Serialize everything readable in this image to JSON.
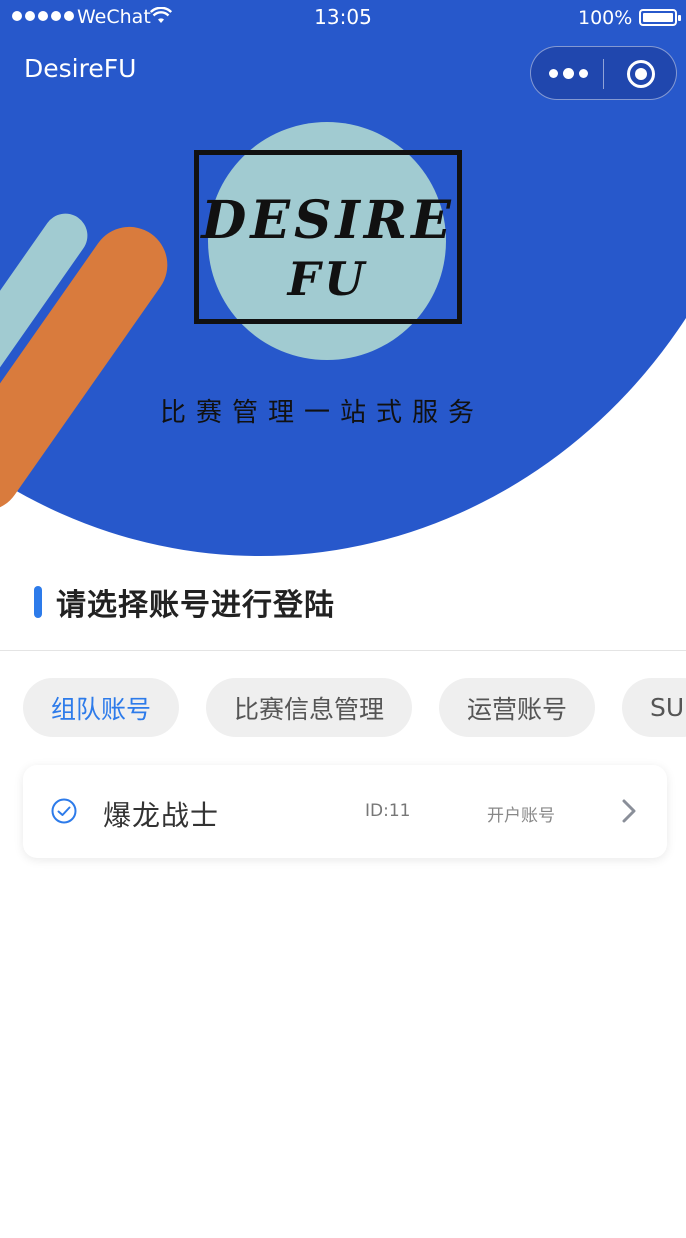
{
  "status_bar": {
    "carrier": "WeChat",
    "time": "13:05",
    "battery": "100%"
  },
  "nav": {
    "title": "DesireFU"
  },
  "hero": {
    "logo_line1": "DESIRE",
    "logo_line2": "FU",
    "tagline": "比赛管理一站式服务"
  },
  "section": {
    "title": "请选择账号进行登陆"
  },
  "tabs": [
    {
      "label": "组队账号",
      "active": true
    },
    {
      "label": "比赛信息管理",
      "active": false
    },
    {
      "label": "运营账号",
      "active": false
    },
    {
      "label": "SU",
      "active": false
    }
  ],
  "accounts": [
    {
      "name": "爆龙战士",
      "id": "ID:11",
      "type": "开户账号",
      "icon": "check-circle-icon"
    }
  ],
  "colors": {
    "brand_blue": "#2758CB",
    "accent_blue": "#2D7BEA",
    "teal": "#A1CBD1",
    "orange": "#D97B3D"
  }
}
